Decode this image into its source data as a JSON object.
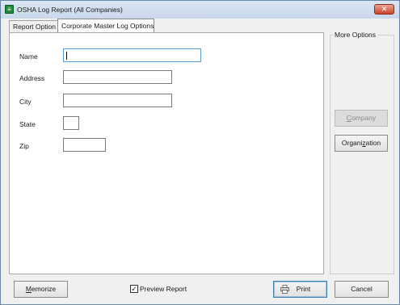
{
  "window": {
    "title": "OSHA Log Report (All Companies)",
    "icon_glyph": "≡",
    "close_glyph": "✕"
  },
  "tabs": [
    {
      "label": "Report Option",
      "active": false
    },
    {
      "label": "Corporate Master Log Options",
      "active": true
    }
  ],
  "form": {
    "fields": [
      {
        "label": "Name",
        "value": ""
      },
      {
        "label": "Address",
        "value": ""
      },
      {
        "label": "City",
        "value": ""
      },
      {
        "label": "State",
        "value": ""
      },
      {
        "label": "Zip",
        "value": ""
      }
    ]
  },
  "more_options": {
    "title": "More Options",
    "company_button": {
      "pre": "",
      "ul": "C",
      "post": "ompany",
      "enabled": false
    },
    "organization_button": {
      "pre": "Organi",
      "ul": "z",
      "post": "ation",
      "enabled": true
    }
  },
  "footer": {
    "memorize_button": {
      "pre": "",
      "ul": "M",
      "post": "emorize"
    },
    "preview_checkbox": {
      "label": "Preview Report",
      "checked": true,
      "check_glyph": "✓"
    },
    "print_button": {
      "label": "Print"
    },
    "cancel_button": {
      "label": "Cancel"
    }
  },
  "colors": {
    "title_bar": "#c9d8ea",
    "close_button": "#c8452c",
    "focus_border": "#5b9bd5",
    "app_icon": "#1f8a3a"
  }
}
